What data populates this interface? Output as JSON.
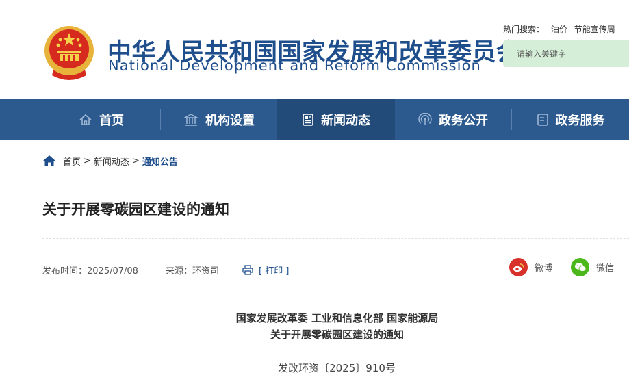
{
  "header": {
    "title_cn": "中华人民共和国国家发展和改革委员会",
    "title_en": "National Development and Reform Commission",
    "hot_search_label": "热门搜索：",
    "hot_keywords": [
      "油价",
      "节能宣传周"
    ],
    "search_placeholder": "请输入关键字"
  },
  "nav": {
    "items": [
      {
        "label": "首页",
        "icon": "home-icon"
      },
      {
        "label": "机构设置",
        "icon": "institution-icon"
      },
      {
        "label": "新闻动态",
        "icon": "news-icon"
      },
      {
        "label": "政务公开",
        "icon": "broadcast-icon"
      },
      {
        "label": "政务服务",
        "icon": "service-icon"
      }
    ],
    "active_index": 2
  },
  "breadcrumb": {
    "items": [
      "首页",
      "新闻动态",
      "通知公告"
    ],
    "separator": ">"
  },
  "article": {
    "title": "关于开展零碳园区建设的通知",
    "publish_label": "发布时间：",
    "publish_date": "2025/07/08",
    "source_label": "来源：",
    "source": "环资司",
    "print_label": "[ 打印 ]",
    "share": [
      {
        "label": "微博",
        "icon": "weibo-icon",
        "color": "#d8302a"
      },
      {
        "label": "微信",
        "icon": "wechat-icon",
        "color": "#4cb81d"
      }
    ],
    "issuers": "国家发展改革委 工业和信息化部 国家能源局",
    "doc_title": "关于开展零碳园区建设的通知",
    "doc_number": "发改环资〔2025〕910号"
  },
  "colors": {
    "brand_blue": "#1e4e8c",
    "nav_bg": "#2c5a8f",
    "nav_active": "#234b7a",
    "search_bg": "#d5eed8"
  }
}
